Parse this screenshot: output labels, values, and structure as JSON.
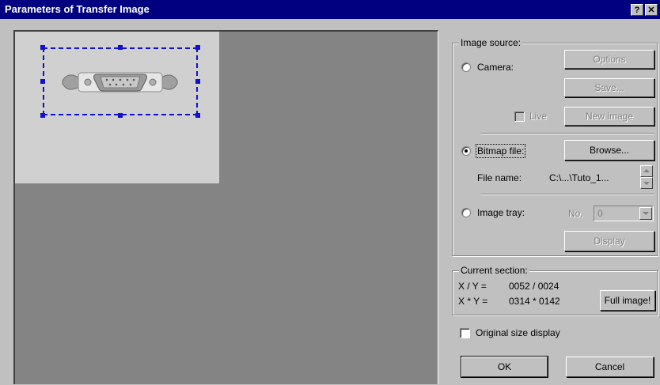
{
  "window": {
    "title": "Parameters of Transfer Image",
    "help_label": "?",
    "close_label": "✕"
  },
  "image_source": {
    "legend": "Image source:",
    "camera": {
      "label": "Camera:",
      "selected": false
    },
    "options_label": "Options",
    "save_label": "Save...",
    "live": {
      "label": "Live",
      "checked": false
    },
    "new_image_label": "New image",
    "bitmap": {
      "label": "Bitmap file:",
      "selected": true
    },
    "browse_label": "Browse...",
    "file_name_label": "File name:",
    "file_name_value": "C:\\...\\Tuto_1...",
    "tray": {
      "label": "Image tray:",
      "selected": false
    },
    "no_label": "No.",
    "no_value": "0",
    "display_label": "Display"
  },
  "current_section": {
    "legend": "Current section:",
    "xy_label": "X / Y =",
    "xy_value": "0052 / 0024",
    "size_label": "X * Y =",
    "size_value": "0314 * 0142",
    "full_image_label": "Full image!"
  },
  "original_size": {
    "label": "Original size display",
    "checked": false
  },
  "buttons": {
    "ok": "OK",
    "cancel": "Cancel"
  },
  "colors": {
    "titlebar": "#000080",
    "selection": "#1010d0",
    "canvas": "#848484",
    "face": "#c0c0c0"
  }
}
